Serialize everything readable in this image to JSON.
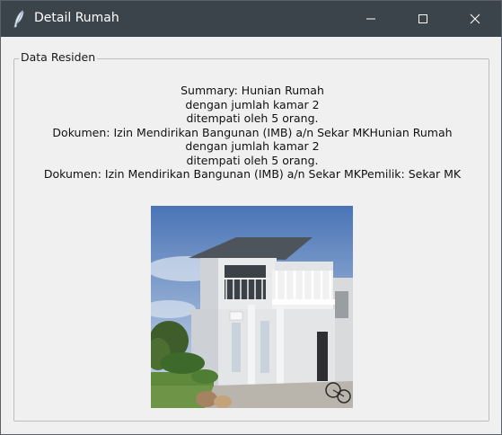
{
  "window": {
    "title": "Detail Rumah",
    "icon": "feather-icon",
    "controls": [
      "minimize-icon",
      "maximize-icon",
      "close-icon"
    ],
    "titlebar_color": "#3b444b",
    "background_color": "#f0f0f0"
  },
  "group": {
    "label": "Data Residen"
  },
  "summary": {
    "lines": [
      "Summary: Hunian Rumah",
      "dengan jumlah kamar 2",
      "ditempati oleh 5 orang.",
      "Dokumen: Izin Mendirikan Bangunan (IMB) a/n Sekar MKHunian Rumah",
      "dengan jumlah kamar 2",
      "ditempati oleh 5 orang.",
      "Dokumen: Izin Mendirikan Bangunan (IMB) a/n Sekar MKPemilik: Sekar MK"
    ]
  },
  "photo": {
    "subject": "two-storey-house-photo"
  }
}
